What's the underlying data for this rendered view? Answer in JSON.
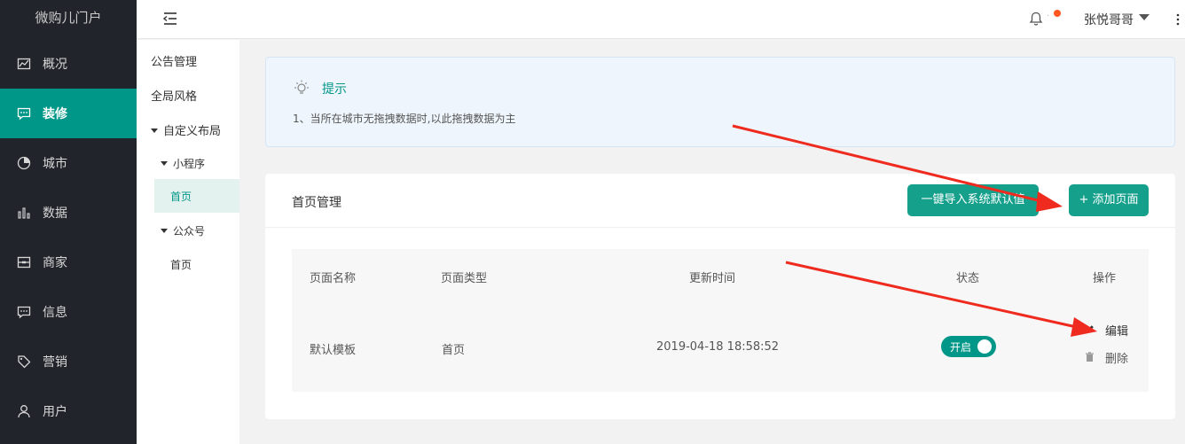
{
  "app": {
    "brand": "微购儿门户"
  },
  "sidebar": {
    "items": [
      {
        "label": "概况",
        "icon": "overview-icon"
      },
      {
        "label": "装修",
        "icon": "decorate-icon",
        "active": true
      },
      {
        "label": "城市",
        "icon": "city-icon"
      },
      {
        "label": "数据",
        "icon": "data-chart-icon"
      },
      {
        "label": "商家",
        "icon": "merchant-icon"
      },
      {
        "label": "信息",
        "icon": "message-icon"
      },
      {
        "label": "营销",
        "icon": "tag-icon"
      },
      {
        "label": "用户",
        "icon": "user-icon"
      }
    ]
  },
  "topbar": {
    "user_name": "张悦哥哥",
    "notification_dot": true
  },
  "submenu": {
    "announcement": "公告管理",
    "global_style": "全局风格",
    "custom_layout": "自定义布局",
    "mini_program": "小程序",
    "mini_home": "首页",
    "official_account": "公众号",
    "official_home": "首页"
  },
  "tip": {
    "title": "提示",
    "text": "1、当所在城市无拖拽数据时,以此拖拽数据为主"
  },
  "card": {
    "title": "首页管理",
    "import_button": "一键导入系统默认值",
    "add_button": "+ 添加页面"
  },
  "table": {
    "headers": [
      "页面名称",
      "页面类型",
      "更新时间",
      "状态",
      "操作"
    ],
    "rows": [
      {
        "name": "默认模板",
        "type": "首页",
        "updated": "2019-04-18 18:58:52",
        "status_label": "开启",
        "status_on": true,
        "edit": "编辑",
        "delete": "删除"
      }
    ]
  },
  "colors": {
    "accent": "#009688",
    "sidebar_bg": "#22242b",
    "annotation_arrow": "#ee2b1e"
  }
}
